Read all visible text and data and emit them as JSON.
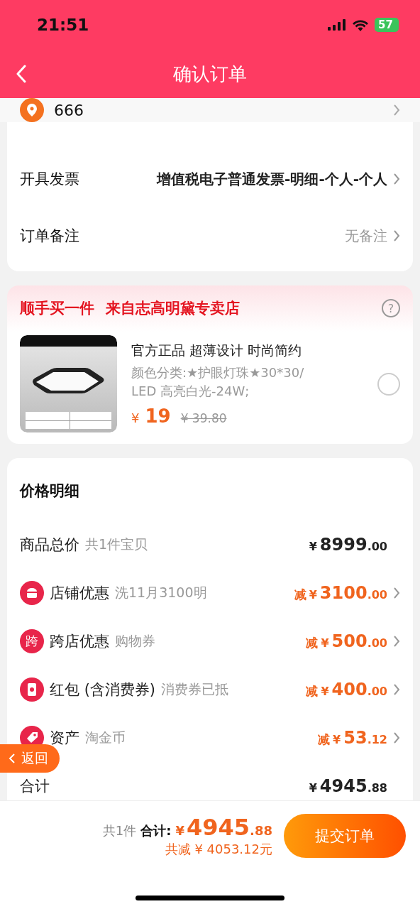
{
  "status_bar": {
    "time": "21:51",
    "battery": "57"
  },
  "nav": {
    "title": "确认订单"
  },
  "address": {
    "name": "666"
  },
  "options": [
    {
      "label": "开具发票",
      "value": "增值税电子普通发票-明细-个人-个人",
      "muted": false
    },
    {
      "label": "订单备注",
      "value": "无备注",
      "muted": true
    }
  ],
  "addon": {
    "title": "顺手买一件",
    "store": "来自志高明黛专卖店",
    "help": "?",
    "product": {
      "kind": "picture",
      "name": "官方正品 超薄设计 时尚简约",
      "spec_lines": [
        "颜色分类:★护眼灯珠★30*30/",
        "LED 高亮白光-24W;"
      ],
      "currency": "¥",
      "price": "19",
      "old_price": "¥ 39.80",
      "selected": false
    }
  },
  "price_detail": {
    "title": "价格明细",
    "rows": [
      {
        "kind": "plain",
        "label": "商品总价",
        "note": "共1件宝贝",
        "prefix": "",
        "currency": "¥",
        "int": "8999",
        "dec": ".00",
        "discount": false,
        "chevron": false
      },
      {
        "kind": "store",
        "label": "店铺优惠",
        "note": "洗11月3100明",
        "prefix": "减",
        "currency": "¥",
        "int": "3100",
        "dec": ".00",
        "discount": true,
        "chevron": true
      },
      {
        "kind": "badge",
        "icon_text": "跨",
        "label": "跨店优惠",
        "note": "购物券",
        "prefix": "减",
        "currency": "¥",
        "int": "500",
        "dec": ".00",
        "discount": true,
        "chevron": true
      },
      {
        "kind": "packet",
        "label": "红包 (含消费券)",
        "note": "消费券已抵",
        "prefix": "减",
        "currency": "¥",
        "int": "400",
        "dec": ".00",
        "discount": true,
        "chevron": true
      },
      {
        "kind": "tag",
        "label": "资产",
        "note": "淘金币",
        "prefix": "减",
        "currency": "¥",
        "int": "53",
        "dec": ".12",
        "discount": true,
        "chevron": true
      }
    ],
    "total": {
      "label": "合计",
      "currency": "¥",
      "int": "4945",
      "dec": ".88"
    }
  },
  "float_back": {
    "label": "返回"
  },
  "footer": {
    "count": "共1件",
    "total_label": "合计:",
    "currency": "¥",
    "int": "4945",
    "dec": ".88",
    "saved": "共减 ¥ 4053.12元",
    "submit": "提交订单"
  }
}
